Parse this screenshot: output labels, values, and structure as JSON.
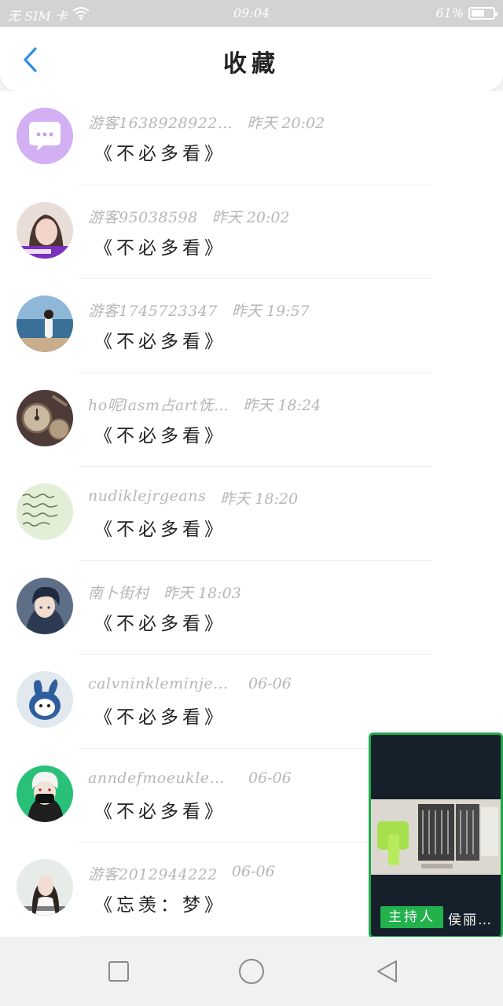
{
  "status_bar": {
    "carrier": "无 SIM 卡",
    "time": "09:04",
    "battery_text": "61%",
    "battery_level": 0.61
  },
  "header": {
    "title": "收藏"
  },
  "favorites": [
    {
      "user": "游客1638928922…",
      "time": "昨天 20:02",
      "title": "《不必多看》",
      "avatar": "chat-bubble"
    },
    {
      "user": "游客95038598",
      "time": "昨天 20:02",
      "title": "《不必多看》",
      "avatar": "girl-photo"
    },
    {
      "user": "游客1745723347",
      "time": "昨天 19:57",
      "title": "《不必多看》",
      "avatar": "beach-photo"
    },
    {
      "user": "ho呢lasm占art怃…",
      "time": "昨天 18:24",
      "title": "《不必多看》",
      "avatar": "watch-photo"
    },
    {
      "user": "nudiklejrgeans",
      "time": "昨天 18:20",
      "title": "《不必多看》",
      "avatar": "handwriting-photo"
    },
    {
      "user": "南卜街村",
      "time": "昨天 18:03",
      "title": "《不必多看》",
      "avatar": "anime-boy"
    },
    {
      "user": "calvninkleminjeans",
      "time": "06-06",
      "title": "《不必多看》",
      "avatar": "cartoon-rabbit"
    },
    {
      "user": "anndefmoeukledme…",
      "time": "06-06",
      "title": "《不必多看》",
      "avatar": "masked-character"
    },
    {
      "user": "游客2012944222",
      "time": "06-06",
      "title": "《忘羡：梦》",
      "avatar": "woman-photo"
    }
  ],
  "floating_window": {
    "host_label": "主持人",
    "host_name": "侯丽…"
  },
  "colors": {
    "accent_blue": "#2d8ce8",
    "host_green": "#22b14c"
  }
}
